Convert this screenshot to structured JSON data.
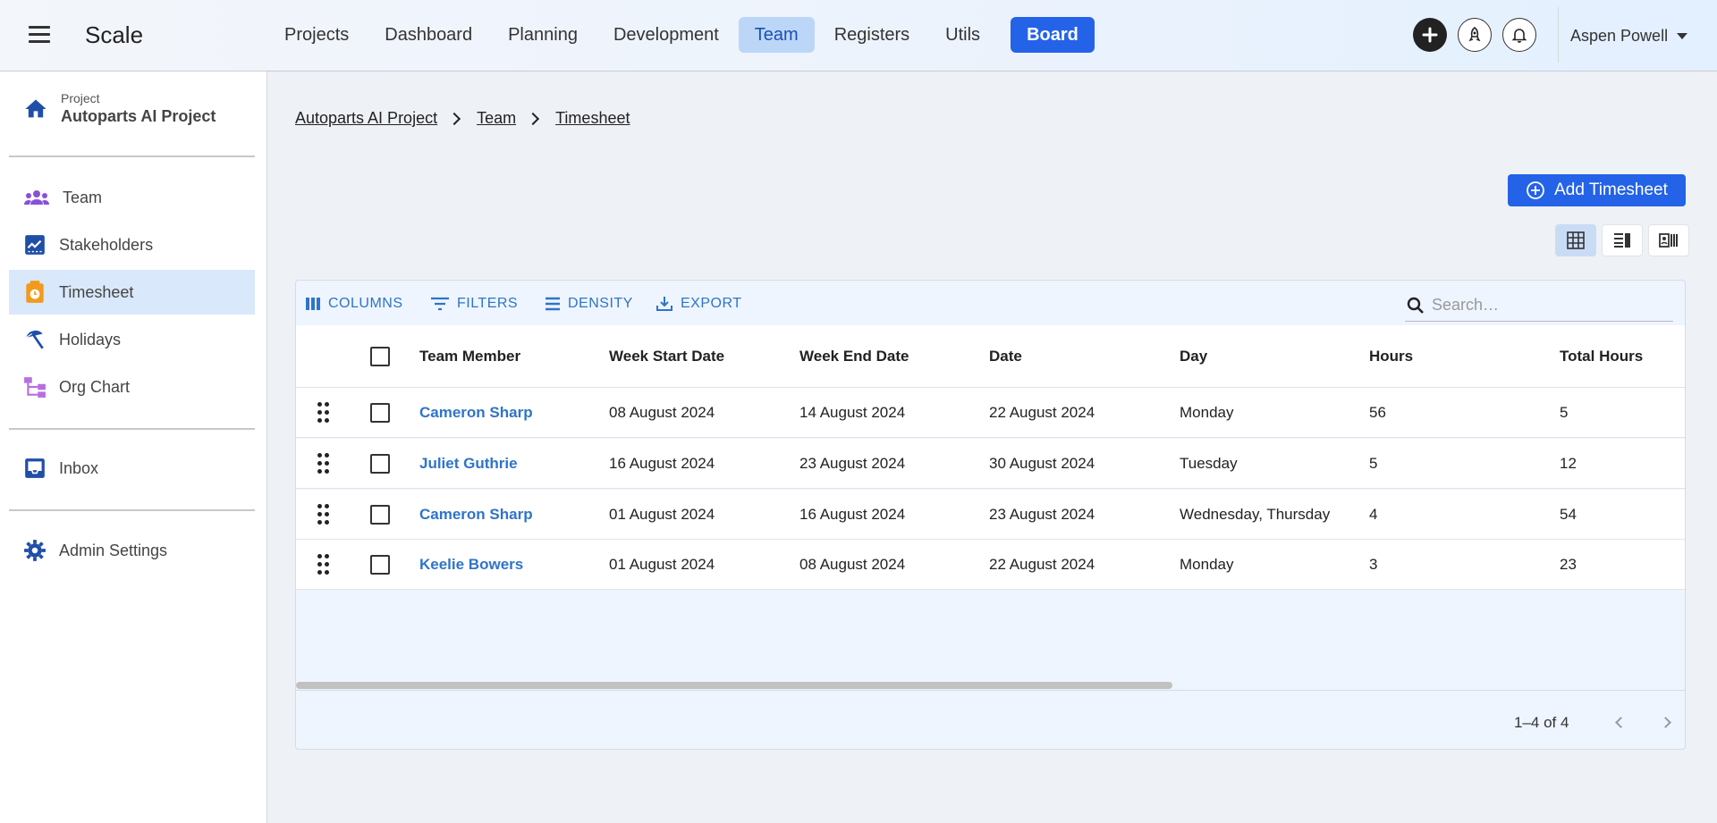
{
  "app": {
    "name": "Scale"
  },
  "nav": {
    "items": [
      {
        "label": "Projects"
      },
      {
        "label": "Dashboard"
      },
      {
        "label": "Planning"
      },
      {
        "label": "Development"
      },
      {
        "label": "Team",
        "active": true
      },
      {
        "label": "Registers"
      },
      {
        "label": "Utils"
      },
      {
        "label": "Board"
      }
    ]
  },
  "header": {
    "icons": [
      "plus-icon",
      "rocket-icon",
      "bell-icon"
    ],
    "user_name": "Aspen Powell"
  },
  "sidebar": {
    "project_label": "Project",
    "project_name": "Autoparts AI Project",
    "items": [
      {
        "label": "Team",
        "icon": "team-icon"
      },
      {
        "label": "Stakeholders",
        "icon": "chart-icon"
      },
      {
        "label": "Timesheet",
        "icon": "timesheet-icon",
        "active": true
      },
      {
        "label": "Holidays",
        "icon": "beach-icon"
      },
      {
        "label": "Org Chart",
        "icon": "org-chart-icon"
      },
      {
        "label": "Inbox",
        "icon": "inbox-icon"
      },
      {
        "label": "Admin Settings",
        "icon": "gear-icon"
      }
    ]
  },
  "breadcrumb": [
    "Autoparts AI Project",
    "Team",
    "Timesheet"
  ],
  "actions": {
    "add_label": "Add Timesheet"
  },
  "toolbar": {
    "columns": "COLUMNS",
    "filters": "FILTERS",
    "density": "DENSITY",
    "export": "EXPORT",
    "search_placeholder": "Search…"
  },
  "table": {
    "headers": [
      "Team Member",
      "Week Start Date",
      "Week End Date",
      "Date",
      "Day",
      "Hours",
      "Total Hours"
    ],
    "rows": [
      [
        "Cameron Sharp",
        "08 August 2024",
        "14 August 2024",
        "22 August 2024",
        "Monday",
        "56",
        "5"
      ],
      [
        "Juliet Guthrie",
        "16 August 2024",
        "23 August 2024",
        "30 August 2024",
        "Tuesday",
        "5",
        "12"
      ],
      [
        "Cameron Sharp",
        "01 August 2024",
        "16 August 2024",
        "23 August 2024",
        "Wednesday, Thursday",
        "4",
        "54"
      ],
      [
        "Keelie Bowers",
        "01 August 2024",
        "08 August 2024",
        "22 August 2024",
        "Monday",
        "3",
        "23"
      ]
    ]
  },
  "pagination": {
    "text": "1–4 of 4"
  },
  "colors": {
    "primary": "#2463e8",
    "link": "#2f74c8",
    "active_nav": "#bcd6f7",
    "sidebar_active": "#dae8fb"
  }
}
